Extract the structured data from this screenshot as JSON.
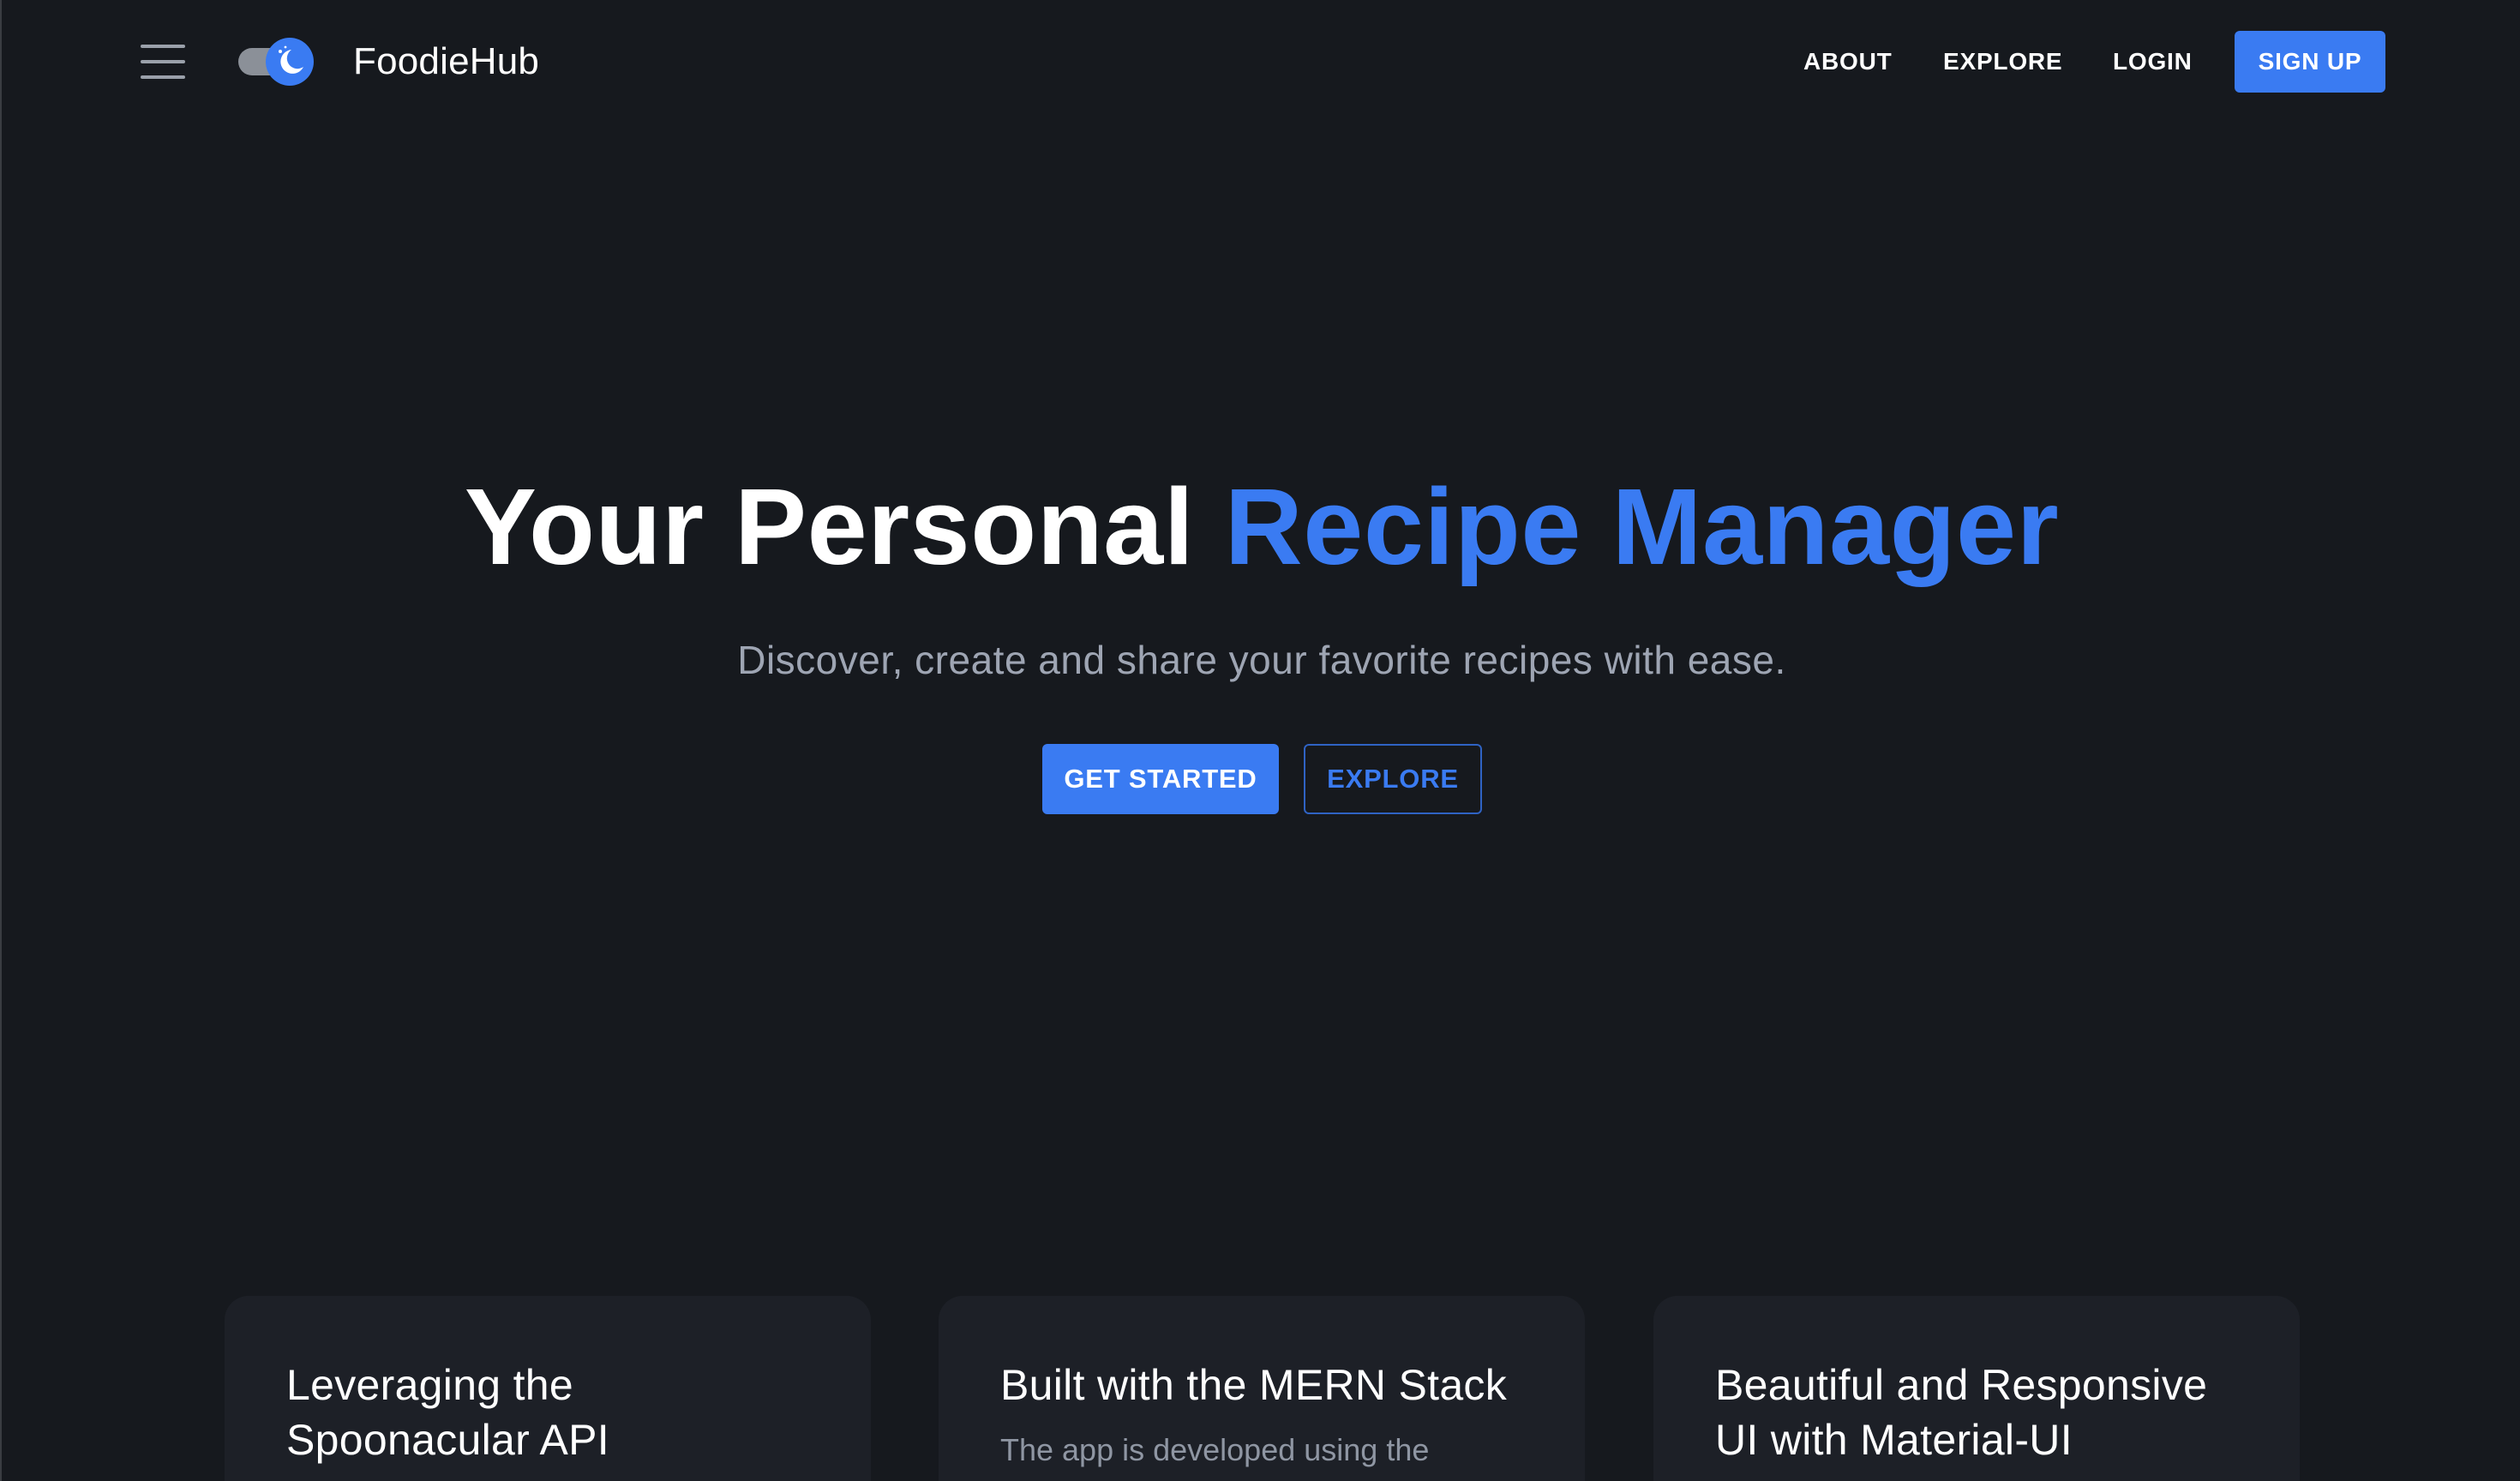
{
  "header": {
    "brand": "FoodieHub",
    "nav": {
      "about": "ABOUT",
      "explore": "EXPLORE",
      "login": "LOGIN",
      "signup": "SIGN UP"
    },
    "icons": {
      "menu": "hamburger-menu-icon",
      "theme_toggle": "moon-icon"
    }
  },
  "hero": {
    "title_plain": "Your Personal ",
    "title_accent": "Recipe Manager",
    "subtitle": "Discover, create and share your favorite recipes with ease.",
    "primary_cta": "GET STARTED",
    "secondary_cta": "EXPLORE"
  },
  "features": [
    {
      "title": "Leveraging the Spoonacular API",
      "text": ""
    },
    {
      "title": "Built with the MERN Stack",
      "text": "The app is developed using the"
    },
    {
      "title": "Beautiful and Responsive UI with Material-UI",
      "text": ""
    }
  ],
  "colors": {
    "background": "#16191e",
    "accent": "#3a7bf2",
    "card": "#1d2027",
    "muted_text": "#9ea5b3"
  }
}
